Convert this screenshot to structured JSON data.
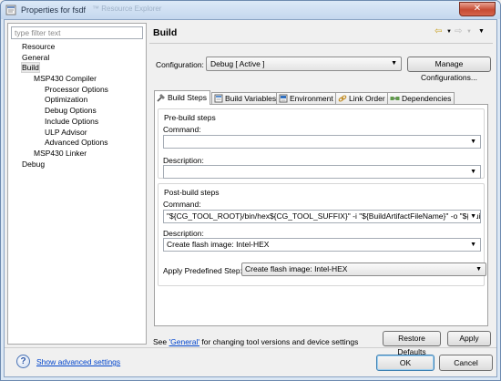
{
  "window": {
    "title": "Properties for fsdf",
    "background_title": "™ Resource Explorer",
    "close_glyph": "✕"
  },
  "left_pane": {
    "filter_placeholder": "type filter text",
    "tree": [
      {
        "label": "Resource",
        "level": 0
      },
      {
        "label": "General",
        "level": 0
      },
      {
        "label": "Build",
        "level": 0,
        "selected": true
      },
      {
        "label": "MSP430 Compiler",
        "level": 1
      },
      {
        "label": "Processor Options",
        "level": 2
      },
      {
        "label": "Optimization",
        "level": 2
      },
      {
        "label": "Debug Options",
        "level": 2
      },
      {
        "label": "Include Options",
        "level": 2
      },
      {
        "label": "ULP Advisor",
        "level": 2
      },
      {
        "label": "Advanced Options",
        "level": 2
      },
      {
        "label": "MSP430 Linker",
        "level": 1
      },
      {
        "label": "Debug",
        "level": 0
      }
    ]
  },
  "header": {
    "title": "Build",
    "icons": [
      "back-arrow-icon",
      "forward-arrow-icon",
      "view-menu-icon"
    ]
  },
  "configuration": {
    "label": "Configuration:",
    "value": "Debug  [ Active ]",
    "manage_label": "Manage Configurations..."
  },
  "tabs": [
    {
      "label": "Build Steps",
      "icon": "build-steps-icon",
      "active": true
    },
    {
      "label": "Build Variables",
      "icon": "build-variables-icon"
    },
    {
      "label": "Environment",
      "icon": "environment-icon"
    },
    {
      "label": "Link Order",
      "icon": "link-order-icon"
    },
    {
      "label": "Dependencies",
      "icon": "dependencies-icon"
    }
  ],
  "pre_build": {
    "title": "Pre-build steps",
    "command_label": "Command:",
    "command_value": "",
    "description_label": "Description:",
    "description_value": ""
  },
  "post_build": {
    "title": "Post-build steps",
    "command_label": "Command:",
    "command_value": "\"${CG_TOOL_ROOT}/bin/hex${CG_TOOL_SUFFIX}\" -i \"${BuildArtifactFileName}\" -o \"${BuildArtifac",
    "description_label": "Description:",
    "description_value": "Create flash image: Intel-HEX",
    "predefined_label": "Apply Predefined Step:",
    "predefined_value": "Create flash image: Intel-HEX"
  },
  "footnote": {
    "prefix": "See ",
    "link": "'General'",
    "suffix": " for changing tool versions and device settings"
  },
  "buttons": {
    "restore_defaults": "Restore Defaults",
    "apply": "Apply",
    "ok": "OK",
    "cancel": "Cancel"
  },
  "bottom": {
    "help_glyph": "?",
    "advanced_link": "Show advanced settings"
  },
  "colors": {
    "link": "#0044cc",
    "title_bar": "#c4d7ee",
    "close_button": "#c74b33"
  }
}
